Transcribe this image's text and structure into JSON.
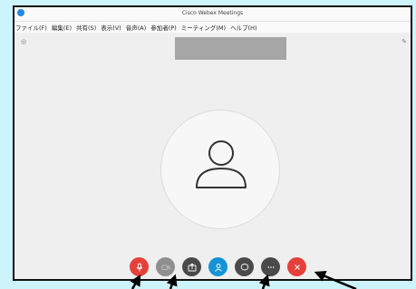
{
  "window": {
    "title": "Cisco Webex Meetings"
  },
  "menu": {
    "items": [
      {
        "label": "ファイル(F)"
      },
      {
        "label": "編集(E)"
      },
      {
        "label": "共有(S)"
      },
      {
        "label": "表示(V)"
      },
      {
        "label": "音声(A)"
      },
      {
        "label": "参加者(P)"
      },
      {
        "label": "ミーティング(M)"
      },
      {
        "label": "ヘルプ(H)"
      }
    ]
  },
  "corner_buttons": {
    "left_icon": "settings-dot-icon",
    "right_icon": "pen-icon"
  },
  "controls": [
    {
      "name": "mute-button",
      "icon": "microphone-icon",
      "color": "#e5403a"
    },
    {
      "name": "video-button",
      "icon": "video-icon",
      "color": "#8f8f8f"
    },
    {
      "name": "share-button",
      "icon": "share-icon",
      "color": "#4a4a4a"
    },
    {
      "name": "participants-button",
      "icon": "person-icon",
      "color": "#1593d6"
    },
    {
      "name": "chat-button",
      "icon": "chat-icon",
      "color": "#4a4a4a"
    },
    {
      "name": "more-button",
      "icon": "more-icon",
      "color": "#4a4a4a"
    },
    {
      "name": "leave-button",
      "icon": "close-icon",
      "color": "#e5403a"
    }
  ],
  "colors": {
    "background": "#cdf3fb",
    "window_bg": "#efefef",
    "arrow": "#000000"
  }
}
